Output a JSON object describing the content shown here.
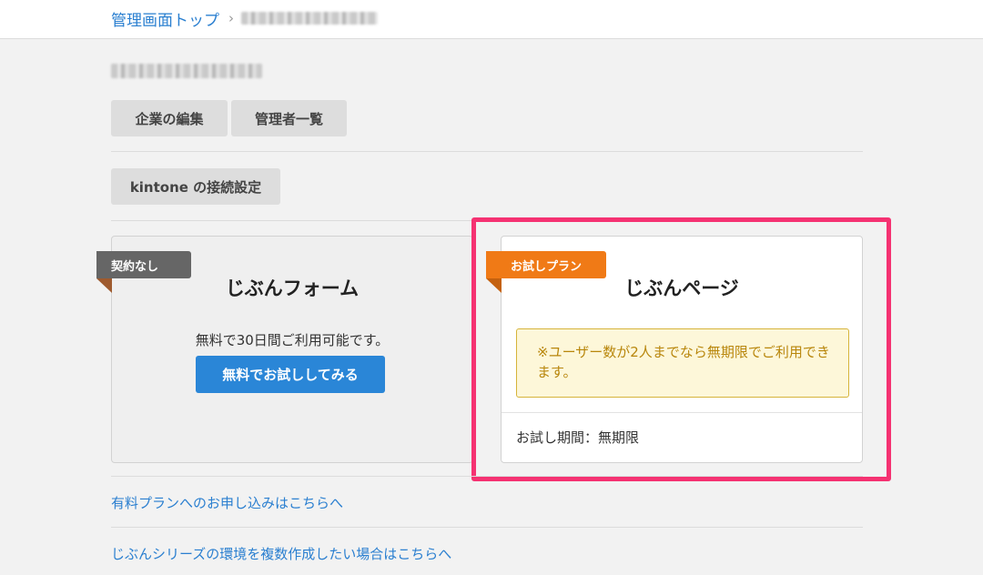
{
  "breadcrumb": {
    "home": "管理画面トップ",
    "separator": "›",
    "current": "(blurred)"
  },
  "company": {
    "name": "(blurred)"
  },
  "buttons": {
    "edit_company": "企業の編集",
    "admin_list": "管理者一覧",
    "kintone_settings": "kintone の接続設定"
  },
  "plans": [
    {
      "badge": "契約なし",
      "title": "じぶんフォーム",
      "description": "無料で30日間ご利用可能です。",
      "action": "無料でお試ししてみる"
    },
    {
      "badge": "お試しプラン",
      "title": "じぶんページ",
      "notice": "※ユーザー数が2人までなら無期限でご利用できます。",
      "trial_period": "お試し期間：無期限"
    }
  ],
  "links": {
    "paid_plan": "有料プランへのお申し込みはこちらへ",
    "multi_env": "じぶんシリーズの環境を複数作成したい場合はこちらへ"
  },
  "colors": {
    "link": "#2a7fd0",
    "primary_button": "#2a86d7",
    "trial_ribbon": "#f07a16",
    "none_ribbon": "#666666",
    "highlight": "#f53272",
    "notice_text": "#b8860b"
  }
}
